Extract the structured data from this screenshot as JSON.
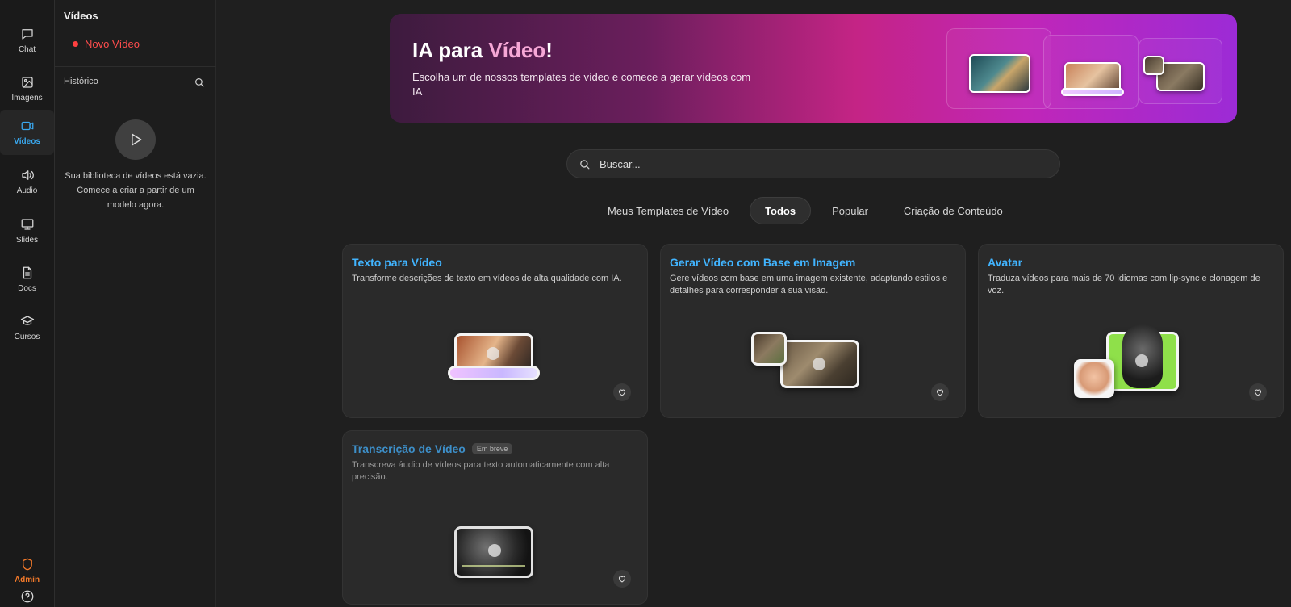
{
  "nav": {
    "items": [
      {
        "label": "Chat",
        "icon": "chat-icon"
      },
      {
        "label": "Imagens",
        "icon": "image-icon"
      },
      {
        "label": "Vídeos",
        "icon": "video-icon"
      },
      {
        "label": "Áudio",
        "icon": "speaker-icon"
      },
      {
        "label": "Slides",
        "icon": "presentation-icon"
      },
      {
        "label": "Docs",
        "icon": "document-icon"
      },
      {
        "label": "Cursos",
        "icon": "graduation-cap-icon"
      }
    ],
    "active": "Vídeos",
    "admin_label": "Admin",
    "help_icon": "help-circle-icon"
  },
  "sidebar": {
    "title": "Vídeos",
    "new_video_label": "Novo Vídeo",
    "history_label": "Histórico",
    "empty_message": "Sua biblioteca de vídeos está vazia. Comece a criar a partir de um modelo agora."
  },
  "banner": {
    "title_prefix": "IA para ",
    "title_highlight": "Vídeo",
    "title_suffix": "!",
    "subtitle": "Escolha um de nossos templates de vídeo e comece a gerar vídeos com IA"
  },
  "search": {
    "placeholder": "Buscar..."
  },
  "tabs": [
    {
      "label": "Meus Templates de Vídeo"
    },
    {
      "label": "Todos"
    },
    {
      "label": "Popular"
    },
    {
      "label": "Criação de Conteúdo"
    }
  ],
  "active_tab": "Todos",
  "cards": [
    {
      "title": "Texto para Vídeo",
      "description": "Transforme descrições de texto em vídeos de alta qualidade com IA."
    },
    {
      "title": "Gerar Vídeo com Base em Imagem",
      "description": "Gere vídeos com base em uma imagem existente, adaptando estilos e detalhes para corresponder à sua visão."
    },
    {
      "title": "Avatar",
      "description": "Traduza vídeos para mais de 70 idiomas com lip-sync e clonagem de voz."
    },
    {
      "title": "Transcrição de Vídeo",
      "badge": "Em breve",
      "description": "Transcreva áudio de vídeos para texto automaticamente com alta precisão."
    }
  ],
  "colors": {
    "accent": "#41b4ff",
    "admin": "#f47a2a",
    "new_video": "#ff4d4d"
  }
}
